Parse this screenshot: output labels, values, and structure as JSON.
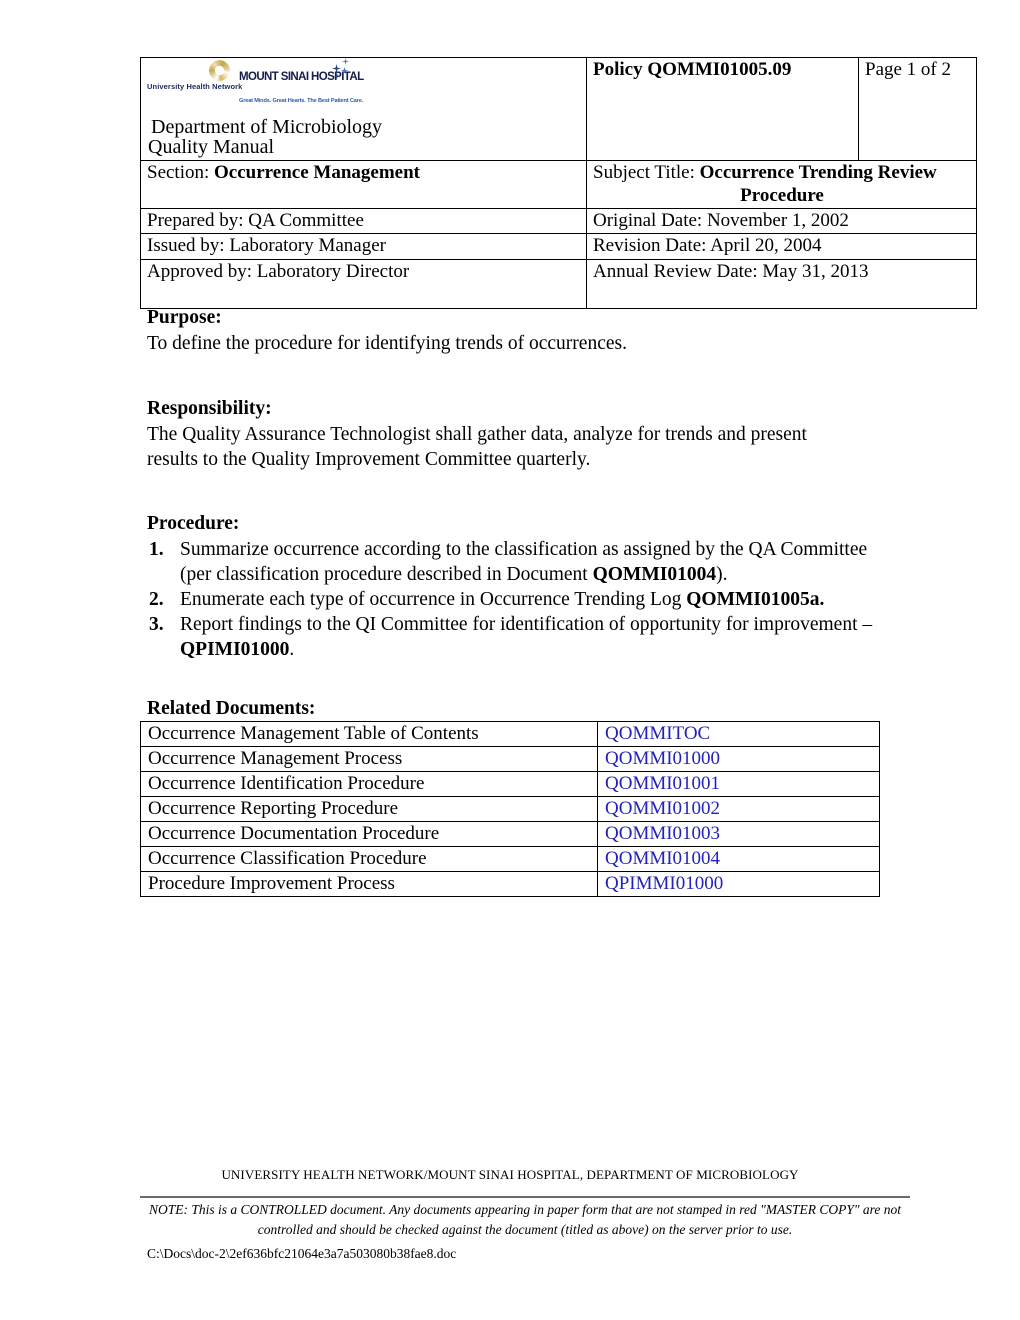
{
  "header": {
    "logo": {
      "uhn_name": "University Health Network",
      "msh_name": "MOUNT SINAI HOSPITAL",
      "msh_tagline": "Great Minds. Great Hearts. The Best Patient Care.",
      "swirl_color": "#c8a44c",
      "navy_color": "#141d4c",
      "blue_color": "#2f5ca8"
    },
    "department_title": "Department of Microbiology",
    "manual_title": "Quality Manual",
    "policy_label": "Policy QOMMI01005.09",
    "page_label": "Page  1 of  2",
    "section_label": "Section:",
    "section_value": "Occurrence Management",
    "subject_label": "Subject Title:",
    "subject_value_line1": "Occurrence Trending Review",
    "subject_value_line2": "Procedure",
    "prepared_by": "Prepared by: QA Committee",
    "original_date": "Original Date: November 1, 2002",
    "issued_by": "Issued by: Laboratory Manager",
    "revision_date": "Revision Date: April 20, 2004",
    "approved_by": "Approved by: Laboratory Director",
    "annual_review_date": "Annual Review Date: May 31, 2013"
  },
  "purpose": {
    "heading": "Purpose:",
    "text": "To define the procedure for identifying trends of occurrences."
  },
  "responsibility": {
    "heading": "Responsibility:",
    "text": "The Quality Assurance Technologist shall gather data, analyze for trends and present results to the Quality Improvement Committee quarterly."
  },
  "procedure": {
    "heading": "Procedure:",
    "steps": [
      {
        "text_before": "Summarize occurrence according to the classification as assigned by the QA Committee (per classification procedure described in Document ",
        "doc_ref": "QOMMI01004",
        "text_after": ")."
      },
      {
        "text_before": "Enumerate each type of occurrence in Occurrence Trending Log ",
        "doc_ref": "QOMMI01005a.",
        "text_after": ""
      },
      {
        "text_before": "Report findings to the QI Committee for identification of opportunity for improvement – ",
        "doc_ref": "QPIMI01000",
        "text_after": "."
      }
    ]
  },
  "related_documents": {
    "heading": "Related Documents:",
    "link_color": "#2222bb",
    "rows": [
      {
        "name": "Occurrence Management Table of Contents",
        "code": "QOMMITOC"
      },
      {
        "name": "Occurrence Management Process",
        "code": "QOMMI01000"
      },
      {
        "name": "Occurrence Identification Procedure",
        "code": "QOMMI01001"
      },
      {
        "name": "Occurrence Reporting Procedure",
        "code": "QOMMI01002"
      },
      {
        "name": "Occurrence Documentation Procedure",
        "code": "QOMMI01003"
      },
      {
        "name": "Occurrence Classification Procedure",
        "code": "QOMMI01004"
      },
      {
        "name": "Procedure Improvement Process",
        "code": "QPIMMI01000"
      }
    ]
  },
  "footer": {
    "organization": "UNIVERSITY HEALTH NETWORK/MOUNT SINAI HOSPITAL, DEPARTMENT OF MICROBIOLOGY",
    "note_line1": "NOTE: This is a CONTROLLED document. Any documents appearing in paper form that are not stamped in red \"MASTER COPY\"",
    "note_line2": "are not controlled and should be checked against the document (titled as above) on the server prior to use.",
    "file_path": "C:\\Docs\\doc-2\\2ef636bfc21064e3a7a503080b38fae8.doc"
  }
}
